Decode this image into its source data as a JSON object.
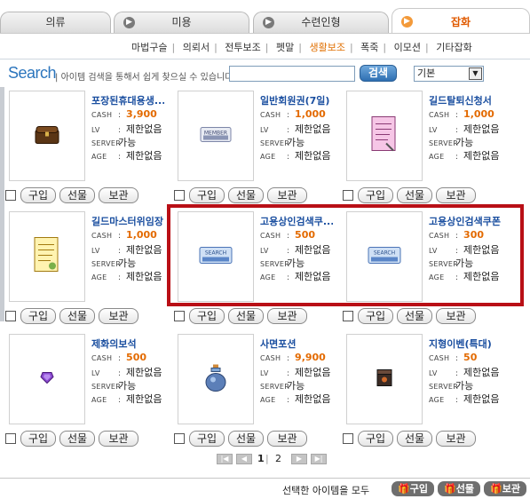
{
  "tabs": [
    {
      "label": "의류",
      "active": false
    },
    {
      "label": "미용",
      "active": false
    },
    {
      "label": "수련인형",
      "active": false
    },
    {
      "label": "잡화",
      "active": true
    }
  ],
  "subnav": [
    "마법구슬",
    "의뢰서",
    "전투보조",
    "펫말",
    "생활보조",
    "폭죽",
    "이모션",
    "기타잡화"
  ],
  "subnav_active": "생활보조",
  "search": {
    "title": "Search",
    "hint": "아이템 검색을 통해서 쉽게 찾으실 수 있습니다.",
    "input_value": "",
    "button_label": "검색",
    "sort_value": "기본"
  },
  "field_labels": {
    "cash": "CASH",
    "lv": "LV",
    "server": "SERVER",
    "age": "AGE"
  },
  "buttons": {
    "buy": "구입",
    "gift": "선물",
    "keep": "보관"
  },
  "items": [
    {
      "name": "포장된휴대용생...",
      "cash": "3,900",
      "lv": "제한없음",
      "server": "가능",
      "age": "제한없음",
      "icon": "chest-icon"
    },
    {
      "name": "일반회원권(7일)",
      "cash": "1,000",
      "lv": "제한없음",
      "server": "가능",
      "age": "제한없음",
      "icon": "member-card-icon"
    },
    {
      "name": "길드탈퇴신청서",
      "cash": "1,000",
      "lv": "제한없음",
      "server": "가능",
      "age": "제한없음",
      "icon": "pink-document-icon"
    },
    {
      "name": "길드마스터위임장",
      "cash": "1,000",
      "lv": "제한없음",
      "server": "가능",
      "age": "제한없음",
      "icon": "yellow-document-icon"
    },
    {
      "name": "고용상인검색쿠...",
      "cash": "500",
      "lv": "제한없음",
      "server": "가능",
      "age": "제한없음",
      "icon": "search-coupon-icon"
    },
    {
      "name": "고용상인검색쿠폰",
      "cash": "300",
      "lv": "제한없음",
      "server": "가능",
      "age": "제한없음",
      "icon": "search-coupon-icon"
    },
    {
      "name": "제화의보석",
      "cash": "500",
      "lv": "제한없음",
      "server": "가능",
      "age": "제한없음",
      "icon": "purple-gem-icon"
    },
    {
      "name": "사면포션",
      "cash": "9,900",
      "lv": "제한없음",
      "server": "가능",
      "age": "제한없음",
      "icon": "potion-icon"
    },
    {
      "name": "지형이벤(특대)",
      "cash": "50",
      "lv": "제한없음",
      "server": "가능",
      "age": "제한없음",
      "icon": "dark-box-icon"
    }
  ],
  "pager": {
    "pages": [
      "1",
      "2"
    ],
    "current": "1",
    "separator": "|"
  },
  "bottom": {
    "text": "선택한 아이템을 모두",
    "buy": "구입",
    "gift": "선물",
    "keep": "보관"
  }
}
